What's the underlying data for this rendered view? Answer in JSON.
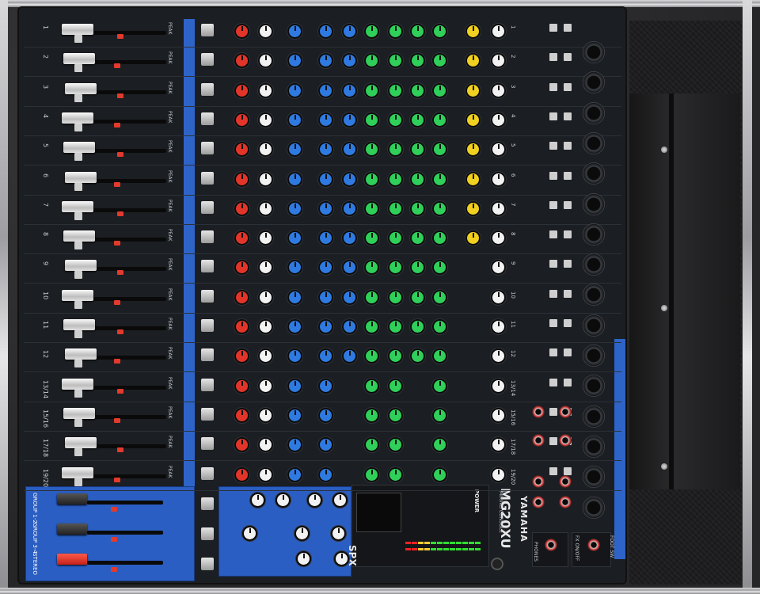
{
  "brand": "YAMAHA",
  "model": "MG20XU",
  "model_subtitle": "MIXING CONSOLE",
  "effects_logo": "SPX",
  "power_label": "POWER",
  "mono_channels": [
    "1",
    "2",
    "3",
    "4",
    "5",
    "6",
    "7",
    "8",
    "9",
    "10",
    "11",
    "12"
  ],
  "stereo_channels": [
    "13/14",
    "15/16",
    "17/18",
    "19/20"
  ],
  "bus_labels": [
    "GROUP 1-2",
    "GROUP 3-4",
    "STEREO"
  ],
  "peak_label": "PEAK",
  "on_label": "ON",
  "phones_label": "PHONES",
  "foot_sw_label": "FOOT SW",
  "fx_on_off_label": "FX ON/OFF",
  "colors": {
    "mixer_body": "#1b1e22",
    "accent_blue": "#2e64c8",
    "knob_red": "#e2352a",
    "knob_blue": "#2f7ae0",
    "knob_green": "#2fcf5a",
    "knob_yellow": "#f0d020",
    "knob_white": "#f2f2f2"
  }
}
